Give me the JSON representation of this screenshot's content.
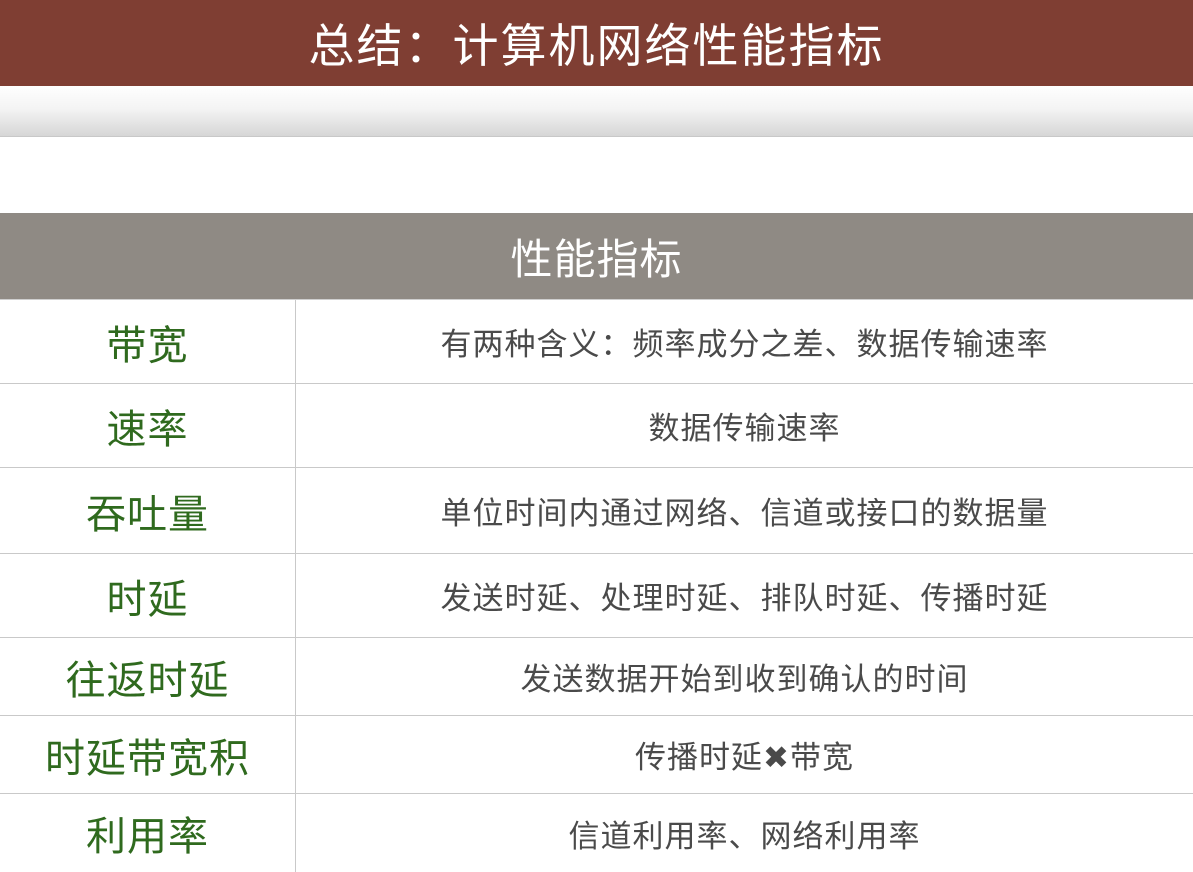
{
  "slide": {
    "title": "总结：计算机网络性能指标"
  },
  "table": {
    "header": "性能指标",
    "rows": [
      {
        "name": "带宽",
        "desc": "有两种含义：频率成分之差、数据传输速率"
      },
      {
        "name": "速率",
        "desc": "数据传输速率"
      },
      {
        "name": "吞吐量",
        "desc": "单位时间内通过网络、信道或接口的数据量"
      },
      {
        "name": "时延",
        "desc": "发送时延、处理时延、排队时延、传播时延"
      },
      {
        "name": "往返时延",
        "desc": "发送数据开始到收到确认的时间"
      },
      {
        "name": "时延带宽积",
        "desc": "传播时延✖带宽"
      },
      {
        "name": "利用率",
        "desc": "信道利用率、网络利用率"
      }
    ]
  },
  "colors": {
    "title_bar": "#7f3e33",
    "table_header": "#8f8a84",
    "name_text": "#2f6a1e",
    "desc_text": "#4a4a4a"
  }
}
